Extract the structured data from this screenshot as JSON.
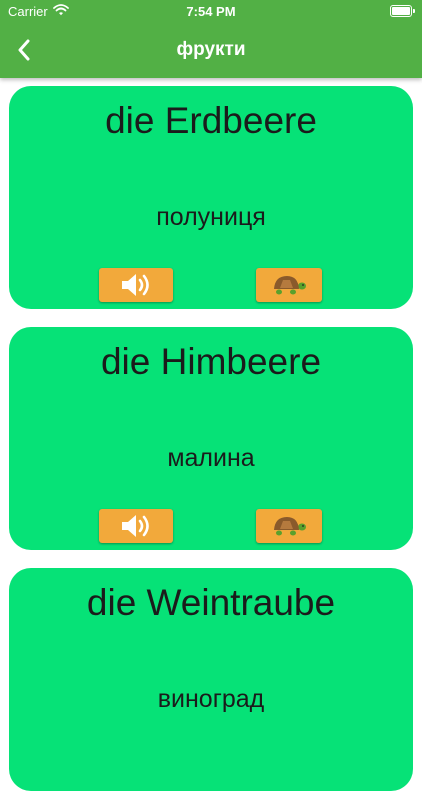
{
  "status_bar": {
    "carrier": "Carrier",
    "time": "7:54 PM"
  },
  "header": {
    "title": "фрукти",
    "back_icon": "chevron-left-icon"
  },
  "colors": {
    "header": "#52b045",
    "card": "#06e277",
    "button": "#f2a93b"
  },
  "cards": [
    {
      "word": "die Erdbeere",
      "translation": "полуниця",
      "sound_icon": "speaker-icon",
      "slow_icon": "turtle-icon"
    },
    {
      "word": "die Himbeere",
      "translation": "малина",
      "sound_icon": "speaker-icon",
      "slow_icon": "turtle-icon"
    },
    {
      "word": "die Weintraube",
      "translation": "виноград",
      "sound_icon": "speaker-icon",
      "slow_icon": "turtle-icon"
    }
  ]
}
